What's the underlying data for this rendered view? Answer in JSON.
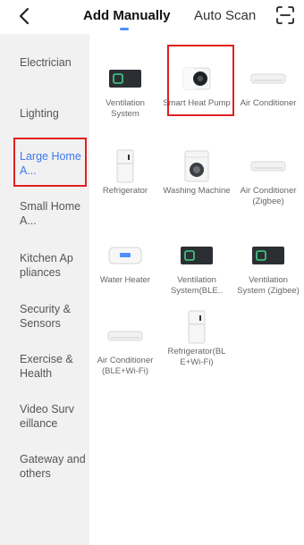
{
  "header": {
    "back_icon": "chevron-left-icon",
    "tab_add_manually": "Add Manually",
    "tab_auto_scan": "Auto Scan",
    "scan_icon": "scan-icon",
    "accent_color": "#4a90ff"
  },
  "sidebar": {
    "items": [
      {
        "label": "Electrician"
      },
      {
        "label": "Lighting"
      },
      {
        "label": "Large Home A..."
      },
      {
        "label": "Small Home A..."
      },
      {
        "label": "Kitchen Ap pliances"
      },
      {
        "label": "Security & Sensors"
      },
      {
        "label": "Exercise & Health"
      },
      {
        "label": "Video Surv eillance"
      },
      {
        "label": "Gateway and others"
      }
    ],
    "active_color": "#3c78f0"
  },
  "devices": [
    {
      "label": "Ventilation System",
      "icon": "ventilation-icon"
    },
    {
      "label": "Smart Heat Pump",
      "icon": "heat-pump-icon"
    },
    {
      "label": "Air Conditioner",
      "icon": "air-conditioner-icon"
    },
    {
      "label": "Refrigerator",
      "icon": "refrigerator-icon"
    },
    {
      "label": "Washing Machine",
      "icon": "washing-machine-icon"
    },
    {
      "label": "Air Conditioner (Zigbee)",
      "icon": "air-conditioner-icon"
    },
    {
      "label": "Water Heater",
      "icon": "water-heater-icon"
    },
    {
      "label": "Ventilation System(BLE..",
      "icon": "ventilation-icon"
    },
    {
      "label": "Ventilation System (Zigbee)",
      "icon": "ventilation-icon"
    },
    {
      "label": "Air Conditioner (BLE+Wi-Fi)",
      "icon": "air-conditioner-icon"
    },
    {
      "label": "Refrigerator(BL E+Wi-Fi)",
      "icon": "refrigerator-icon"
    }
  ],
  "highlight_color": "#e02020"
}
